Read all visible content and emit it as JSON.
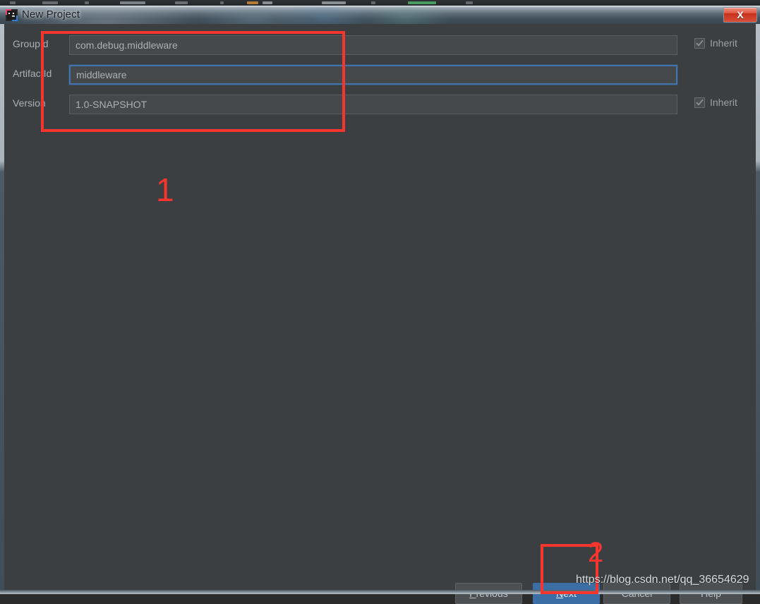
{
  "window": {
    "title": "New Project",
    "app_icon": "intellij-idea-icon",
    "close_label": "X",
    "close_icon": "close-icon"
  },
  "form": {
    "rows": [
      {
        "label": "GroupId",
        "value": "com.debug.middleware",
        "placeholder": "",
        "focused": false,
        "inherit": {
          "label": "Inherit",
          "checked": true,
          "enabled": false
        }
      },
      {
        "label": "ArtifactId",
        "value": "middleware",
        "placeholder": "",
        "focused": true,
        "inherit": null
      },
      {
        "label": "Version",
        "value": "1.0-SNAPSHOT",
        "placeholder": "",
        "focused": false,
        "inherit": {
          "label": "Inherit",
          "checked": true,
          "enabled": false
        }
      }
    ]
  },
  "buttons": {
    "previous": {
      "label": "Previous",
      "mnemonic": "P",
      "primary": false
    },
    "next": {
      "label": "Next",
      "mnemonic": "N",
      "primary": true
    },
    "cancel": {
      "label": "Cancel",
      "mnemonic": "",
      "primary": false
    },
    "help": {
      "label": "Help",
      "mnemonic": "",
      "primary": false
    }
  },
  "annotations": {
    "step_one": "1",
    "step_two": "2"
  },
  "watermark": "https://blog.csdn.net/qq_36654629",
  "colors": {
    "panel_bg": "#3c3f41",
    "input_bg": "#45494b",
    "accent_blue": "#3a6ea5",
    "focus_border": "#3f74aa",
    "annotation_red": "#f6352f",
    "text": "#a9b0b5",
    "close_red": "#d8503a"
  }
}
